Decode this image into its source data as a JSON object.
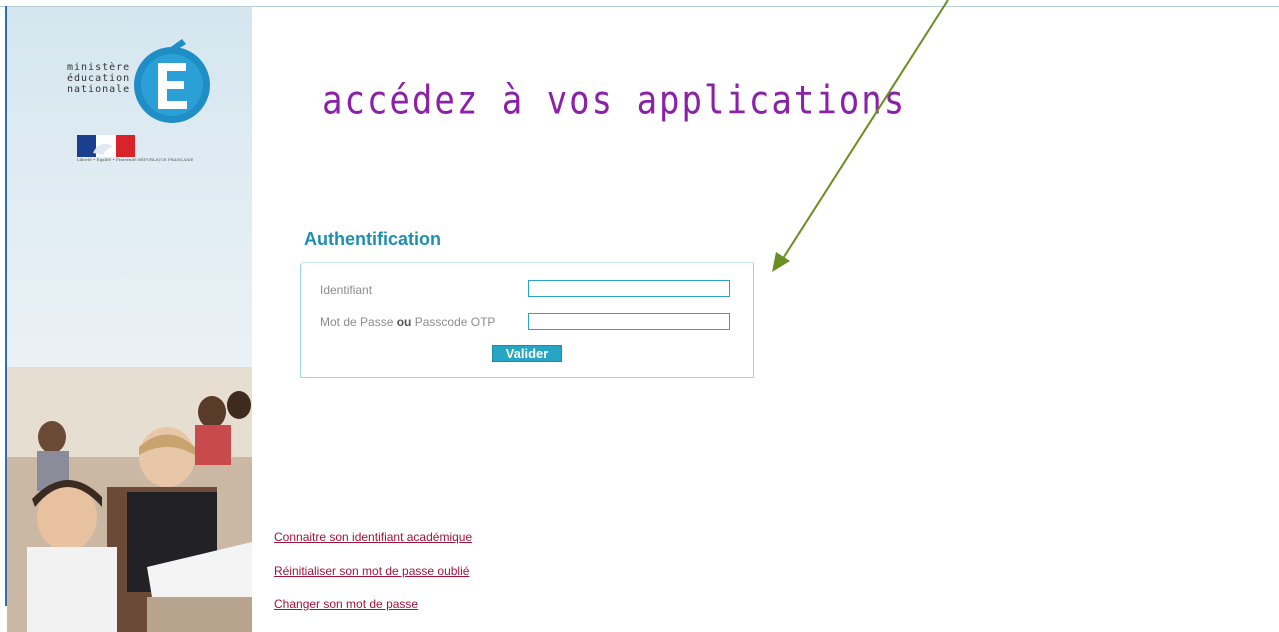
{
  "logo": {
    "line1": "ministère",
    "line2": "éducation",
    "line3": "nationale",
    "letter": "É",
    "flag_caption": "Liberté • Égalité • Fraternité  RÉPUBLIQUE FRANÇAISE"
  },
  "headline": "accédez à vos applications",
  "auth": {
    "title": "Authentification",
    "identifiant_label": "Identifiant",
    "password_label_pre": "Mot de Passe ",
    "password_label_or": "ou",
    "password_label_post": " Passcode OTP",
    "identifiant_value": "",
    "password_value": "",
    "submit_label": "Valider"
  },
  "links": {
    "know_id": "Connaitre son identifiant académique",
    "reset_password": "Réinitialiser son mot de passe oublié",
    "change_password": "Changer son mot de passe"
  },
  "colors": {
    "headline": "#8a21a8",
    "auth_title": "#1e8fb0",
    "button": "#27a5c4",
    "links": "#a0143c",
    "arrow": "#6b8e23"
  },
  "icons": {
    "logo": "ministere-education-nationale-logo",
    "flag": "republique-francaise-flag",
    "annotation": "green-arrow-icon"
  }
}
